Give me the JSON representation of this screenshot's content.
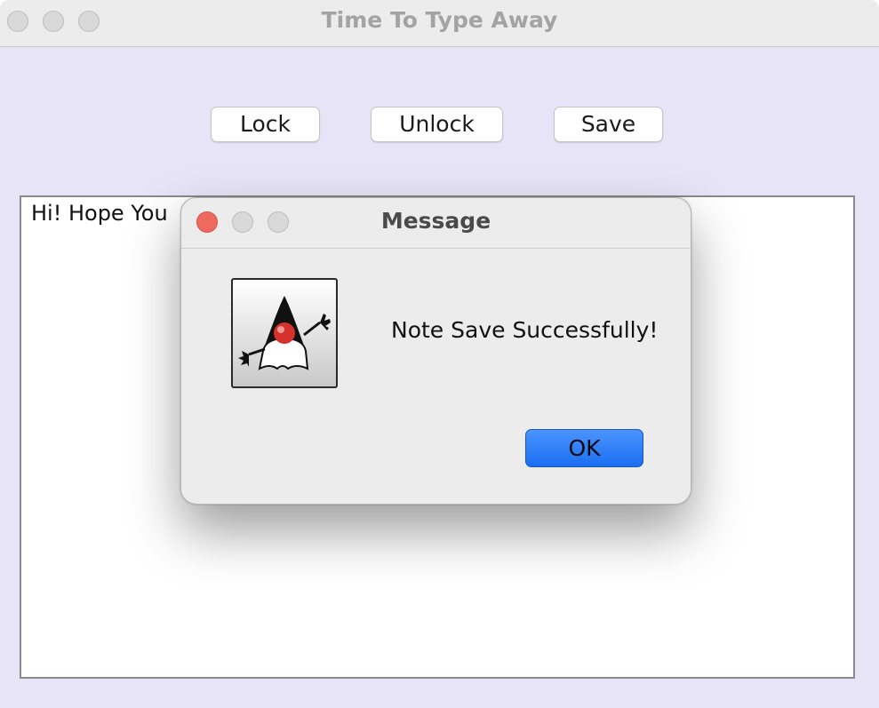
{
  "window": {
    "title": "Time To Type Away"
  },
  "toolbar": {
    "lock_label": "Lock",
    "unlock_label": "Unlock",
    "save_label": "Save"
  },
  "editor": {
    "content": "Hi! Hope You"
  },
  "dialog": {
    "title": "Message",
    "message": "Note Save Successfully!",
    "ok_label": "OK",
    "icon": "java-duke-icon"
  },
  "colors": {
    "window_background": "#e6e4f6",
    "close_red": "#ee6a5f",
    "ok_blue": "#2a7cf6"
  }
}
